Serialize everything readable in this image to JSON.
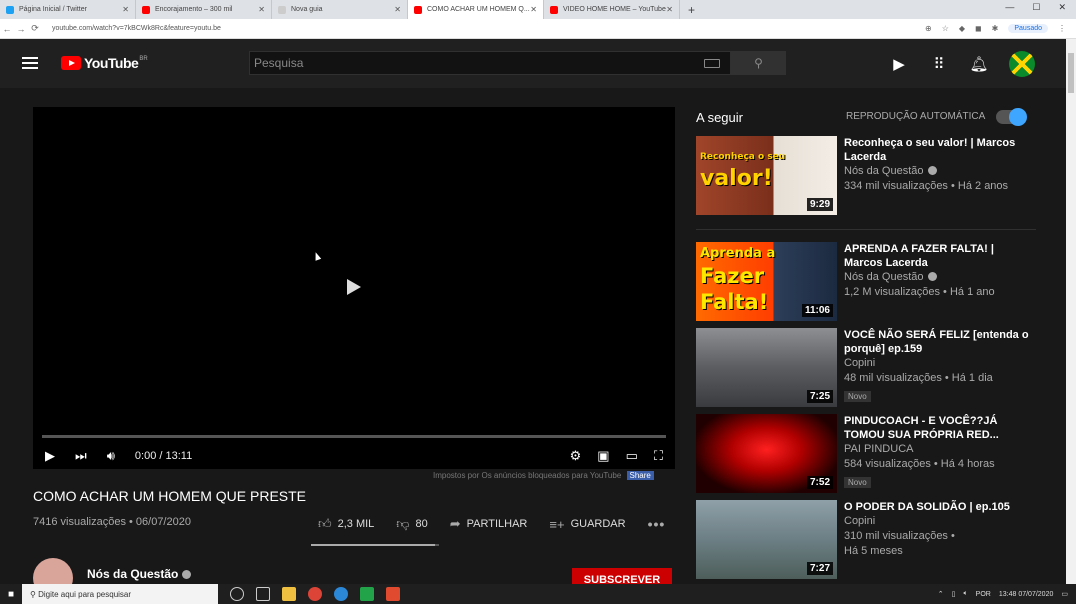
{
  "browser": {
    "tabs": [
      {
        "label": "Página Inicial / Twitter",
        "color": "#1da1f2",
        "active": false
      },
      {
        "label": "Encorajamento – 300 mil",
        "color": "#ff0000",
        "active": false
      },
      {
        "label": "Nova guia",
        "color": "#cccccc",
        "active": false
      },
      {
        "label": "COMO ACHAR UM HOMEM Q...",
        "color": "#ff0000",
        "active": true
      },
      {
        "label": "VIDEO HOME HOME – YouTube",
        "color": "#ff0000",
        "active": false
      }
    ],
    "url": "youtube.com/watch?v=7kBCWk8Rc&feature=youtu.be",
    "profile_badge": "Pausado"
  },
  "header": {
    "logo_text": "YouTube",
    "country": "BR",
    "search_placeholder": "Pesquisa"
  },
  "player": {
    "time": "0:00 / 13:11",
    "progress": 0,
    "ads_text": "Impostos por Os anúncios bloqueados para YouTube",
    "share_label": "Share"
  },
  "video": {
    "title": "COMO ACHAR UM HOMEM QUE PRESTE",
    "meta": "7416 visualizações • 06/07/2020",
    "likes": "2,3 MIL",
    "dislikes": "80",
    "share": "PARTILHAR",
    "save": "GUARDAR",
    "like_ratio": 0.97,
    "channel": "Nós da Questão",
    "subscribe": "SUBSCREVER"
  },
  "sidebar": {
    "up_next": "A seguir",
    "autoplay": "REPRODUÇÃO AUTOMÁTICA",
    "items": [
      {
        "title": "Reconheça o seu valor! | Marcos Lacerda",
        "channel": "Nós da Questão",
        "views": "334 mil visualizações • Há 2 anos",
        "duration": "9:29",
        "badge": ""
      },
      {
        "title": "APRENDA A FAZER FALTA! | Marcos Lacerda",
        "channel": "Nós da Questão",
        "views": "1,2 M visualizações • Há 1 ano",
        "duration": "11:06",
        "badge": ""
      },
      {
        "title": "VOCÊ NÃO SERÁ FELIZ [entenda o porquê] ep.159",
        "channel": "Copini",
        "views": "48 mil visualizações • Há 1 dia",
        "duration": "7:25",
        "badge": "Novo"
      },
      {
        "title": "PINDUCOACH - E VOCÊ??JÁ TOMOU SUA PRÓPRIA RED...",
        "channel": "PAI PINDUCA",
        "views": "584 visualizações • Há 4 horas",
        "duration": "7:52",
        "badge": "Novo"
      },
      {
        "title": "O PODER DA SOLIDÃO | ep.105",
        "channel": "Copini",
        "views": "310 mil visualizações •",
        "views2": "Há 5 meses",
        "duration": "7:27",
        "badge": ""
      }
    ],
    "thumb_texts": [
      "Reconheça o seu",
      "valor!",
      "Aprenda a",
      "Fazer",
      "Falta!"
    ]
  },
  "taskbar": {
    "search": "Digite aqui para pesquisar",
    "lang": "POR",
    "time": "13:48",
    "date": "07/07/2020"
  }
}
